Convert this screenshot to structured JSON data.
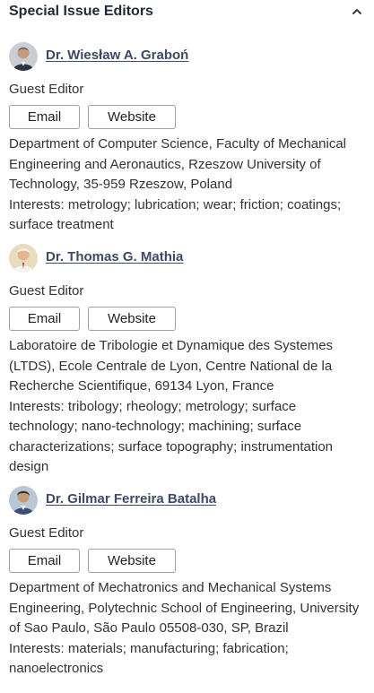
{
  "section": {
    "title": "Special Issue Editors"
  },
  "editors": [
    {
      "name": "Dr. Wiesław A. Graboń",
      "role": "Guest Editor",
      "email_label": "Email",
      "website_label": "Website",
      "affiliation": "Department of Computer Science, Faculty of Mechanical Engineering and Aeronautics, Rzeszow University of Technology, 35-959 Rzeszow, Poland",
      "interests": "Interests: metrology; lubrication; wear; friction; coatings; surface treatment"
    },
    {
      "name": "Dr. Thomas G. Mathia",
      "role": "Guest Editor",
      "email_label": "Email",
      "website_label": "Website",
      "affiliation": "Laboratoire de Tribologie et Dynamique des Systemes (LTDS), Ecole Centrale de Lyon, Centre National de la Recherche Scientifique, 69134 Lyon, France",
      "interests": "Interests: tribology; rheology; metrology; surface technology; nano-technology; machining; surface characterizations; surface topography; instrumentation design"
    },
    {
      "name": "Dr. Gilmar Ferreira Batalha",
      "role": "Guest Editor",
      "email_label": "Email",
      "website_label": "Website",
      "affiliation": "Department of Mechatronics and Mechanical Systems Engineering, Polytechnic School of Engineering, University of Sao Paulo, São Paulo 05508-030, SP, Brazil",
      "interests": "Interests: materials; manufacturing; fabrication; nanoelectronics"
    }
  ]
}
